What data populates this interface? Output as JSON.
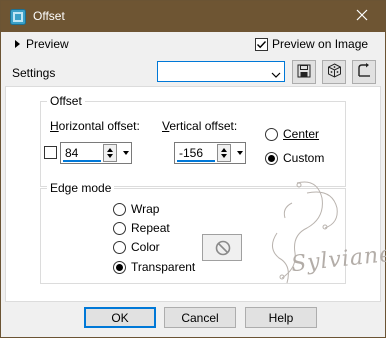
{
  "window": {
    "title": "Offset",
    "close_icon": "close-icon",
    "app_icon": "offset-app-icon"
  },
  "preview": {
    "toggle_label": "Preview",
    "preview_on_image_label": "Preview on Image",
    "preview_on_image_checked": true
  },
  "settings": {
    "label": "Settings",
    "value": ""
  },
  "offset": {
    "group_title": "Offset",
    "horizontal_label": "Horizontal offset:",
    "vertical_label": "Vertical offset:",
    "horizontal_value": "84",
    "vertical_value": "-156",
    "link_checked": false,
    "center_label": "Center",
    "custom_label": "Custom",
    "selected": "custom"
  },
  "edge_mode": {
    "group_title": "Edge mode",
    "options": [
      "Wrap",
      "Repeat",
      "Color",
      "Transparent"
    ],
    "selected": "Transparent"
  },
  "buttons": {
    "ok": "OK",
    "cancel": "Cancel",
    "help": "Help"
  },
  "watermark": {
    "text": "Sylviane"
  },
  "colors": {
    "titlebar": "#6e5533",
    "accent": "#0078d7"
  }
}
